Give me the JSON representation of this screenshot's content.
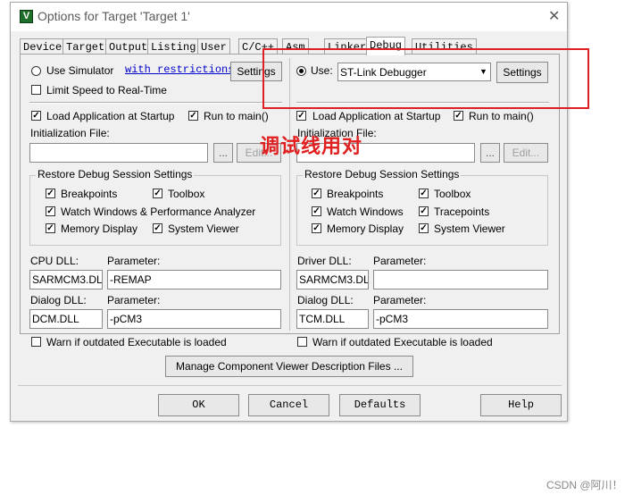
{
  "window": {
    "title": "Options for Target 'Target 1'",
    "app_icon_letter": "V"
  },
  "tabs": [
    "Device",
    "Target",
    "Output",
    "Listing",
    "User",
    "C/C++",
    "Asm",
    "Linker",
    "Debug",
    "Utilities"
  ],
  "left": {
    "simulator_label": "Use Simulator",
    "restrictions_link": "with restrictions",
    "settings_label": "Settings",
    "limit_speed_label": "Limit Speed to Real-Time",
    "load_app_label": "Load Application at Startup",
    "run_main_label": "Run to main()",
    "init_file_label": "Initialization File:",
    "browse_label": "...",
    "edit_label": "Edit...",
    "restore_title": "Restore Debug Session Settings",
    "breakpoints_label": "Breakpoints",
    "toolbox_label": "Toolbox",
    "watch_label": "Watch Windows & Performance Analyzer",
    "memory_label": "Memory Display",
    "sysviewer_label": "System Viewer",
    "cpu_dll_label": "CPU DLL:",
    "param_label": "Parameter:",
    "cpu_dll_value": "SARMCM3.DLL",
    "cpu_param_value": "-REMAP",
    "dialog_dll_label": "Dialog DLL:",
    "dialog_dll_value": "DCM.DLL",
    "dialog_param_value": "-pCM3",
    "warn_label": "Warn if outdated Executable is loaded"
  },
  "right": {
    "use_label": "Use:",
    "debugger_value": "ST-Link Debugger",
    "settings_label": "Settings",
    "load_app_label": "Load Application at Startup",
    "run_main_label": "Run to main()",
    "init_file_label": "Initialization File:",
    "browse_label": "...",
    "edit_label": "Edit...",
    "restore_title": "Restore Debug Session Settings",
    "breakpoints_label": "Breakpoints",
    "toolbox_label": "Toolbox",
    "watch_label": "Watch Windows",
    "tracepoints_label": "Tracepoints",
    "memory_label": "Memory Display",
    "sysviewer_label": "System Viewer",
    "driver_dll_label": "Driver DLL:",
    "param_label": "Parameter:",
    "driver_dll_value": "SARMCM3.DLL",
    "driver_param_value": "",
    "dialog_dll_label": "Dialog DLL:",
    "dialog_dll_value": "TCM.DLL",
    "dialog_param_value": "-pCM3",
    "warn_label": "Warn if outdated Executable is loaded"
  },
  "manage_button": "Manage Component Viewer Description Files ...",
  "footer": {
    "ok": "OK",
    "cancel": "Cancel",
    "defaults": "Defaults",
    "help": "Help"
  },
  "annotation": {
    "text": "调试线用对",
    "color": "#e02020"
  },
  "watermark": "CSDN @阿川！",
  "colors": {
    "highlight_box": "#e02020",
    "link": "#0000cc"
  }
}
